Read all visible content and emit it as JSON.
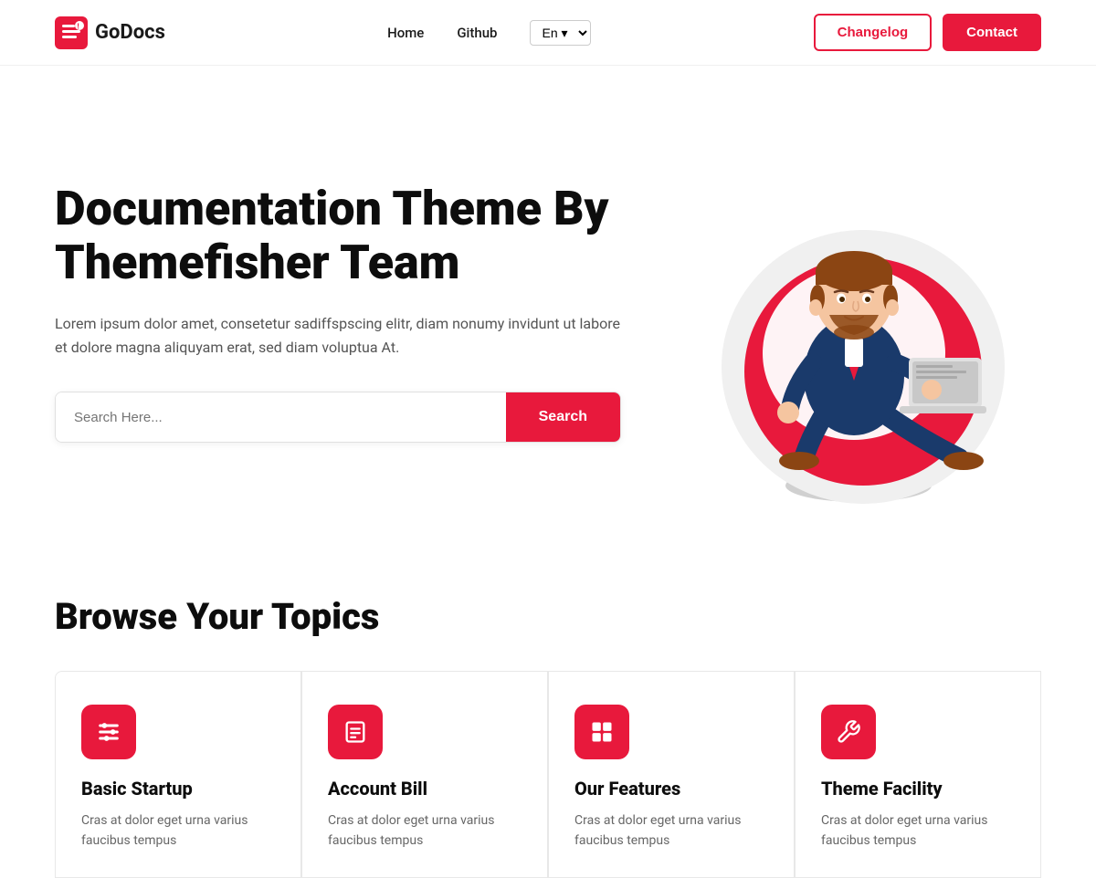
{
  "nav": {
    "logo_text": "GoDocs",
    "links": [
      {
        "label": "Home",
        "href": "#"
      },
      {
        "label": "Github",
        "href": "#"
      }
    ],
    "language_select": "En",
    "changelog_label": "Changelog",
    "contact_label": "Contact"
  },
  "hero": {
    "title": "Documentation Theme By Themefisher Team",
    "description": "Lorem ipsum dolor amet, consetetur sadiffspscing elitr, diam nonumy invidunt ut labore et dolore magna aliquyam erat, sed diam voluptua At.",
    "search_placeholder": "Search Here...",
    "search_button_label": "Search"
  },
  "browse": {
    "title": "Browse Your Topics",
    "cards": [
      {
        "icon": "sliders",
        "title": "Basic Startup",
        "description": "Cras at dolor eget urna varius faucibus tempus"
      },
      {
        "icon": "bill",
        "title": "Account Bill",
        "description": "Cras at dolor eget urna varius faucibus tempus"
      },
      {
        "icon": "features",
        "title": "Our Features",
        "description": "Cras at dolor eget urna varius faucibus tempus"
      },
      {
        "icon": "wrench",
        "title": "Theme Facility",
        "description": "Cras at dolor eget urna varius faucibus tempus"
      }
    ]
  }
}
